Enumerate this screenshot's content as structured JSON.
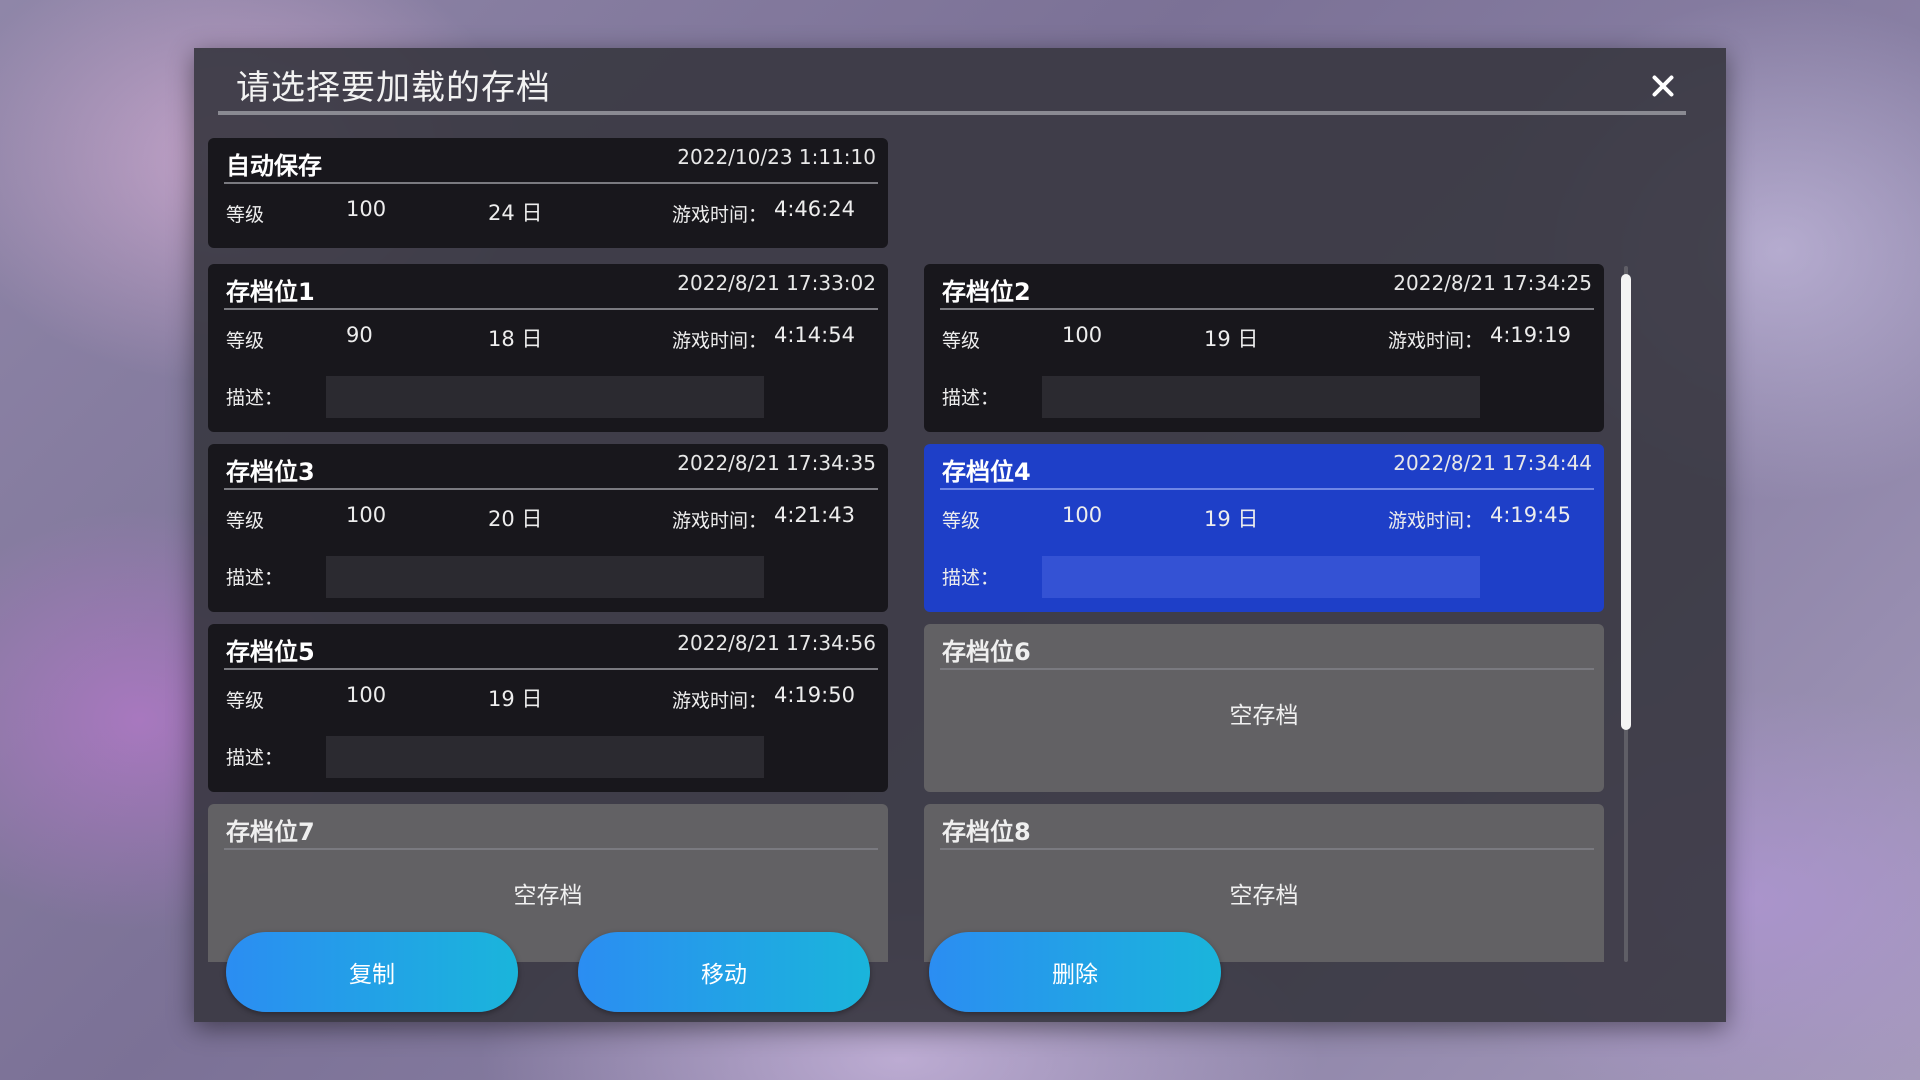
{
  "dialog": {
    "title": "请选择要加载的存档",
    "close_symbol": "✕"
  },
  "labels": {
    "level": "等级",
    "playtime": "游戏时间：",
    "description": "描述：",
    "empty": "空存档"
  },
  "autosave": {
    "name": "自动保存",
    "date": "2022/10/23 1:11:10",
    "level": "100",
    "day": "24 日",
    "playtime": "4:46:24"
  },
  "slots": [
    {
      "name": "存档位1",
      "date": "2022/8/21 17:33:02",
      "level": "90",
      "day": "18 日",
      "playtime": "4:14:54",
      "description": ""
    },
    {
      "name": "存档位2",
      "date": "2022/8/21 17:34:25",
      "level": "100",
      "day": "19 日",
      "playtime": "4:19:19",
      "description": ""
    },
    {
      "name": "存档位3",
      "date": "2022/8/21 17:34:35",
      "level": "100",
      "day": "20 日",
      "playtime": "4:21:43",
      "description": ""
    },
    {
      "name": "存档位4",
      "date": "2022/8/21 17:34:44",
      "level": "100",
      "day": "19 日",
      "playtime": "4:19:45",
      "description": "",
      "selected": true
    },
    {
      "name": "存档位5",
      "date": "2022/8/21 17:34:56",
      "level": "100",
      "day": "19 日",
      "playtime": "4:19:50",
      "description": ""
    },
    {
      "name": "存档位6",
      "empty": true
    },
    {
      "name": "存档位7",
      "empty": true
    },
    {
      "name": "存档位8",
      "empty": true
    }
  ],
  "buttons": {
    "copy": "复制",
    "move": "移动",
    "delete": "删除"
  },
  "colors": {
    "selected_slot": "#1e3fc8",
    "filled_slot": "#18171c",
    "empty_slot": "#626164",
    "button_gradient_start": "#2b8df2",
    "button_gradient_end": "#1ab5db"
  }
}
